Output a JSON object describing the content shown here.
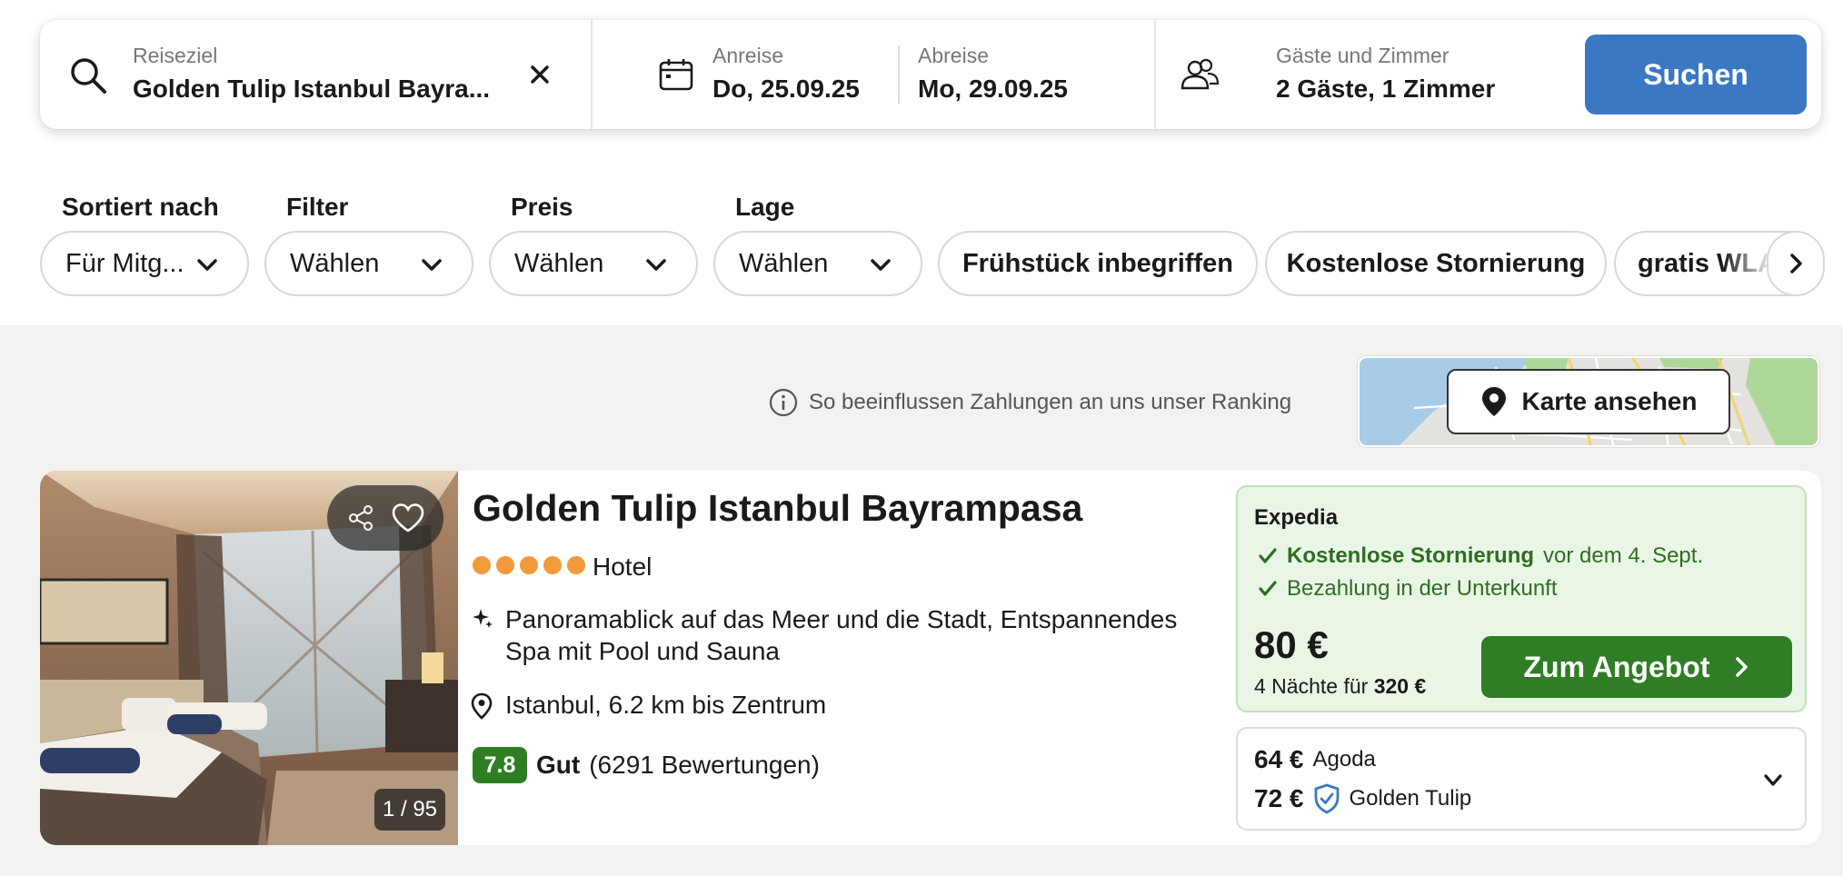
{
  "search": {
    "destination_label": "Reiseziel",
    "destination_value": "Golden Tulip Istanbul Bayra...",
    "checkin_label": "Anreise",
    "checkin_value": "Do, 25.09.25",
    "checkout_label": "Abreise",
    "checkout_value": "Mo, 29.09.25",
    "guests_label": "Gäste und Zimmer",
    "guests_value": "2 Gäste, 1 Zimmer",
    "search_button": "Suchen"
  },
  "filters": {
    "sort_label": "Sortiert nach",
    "sort_value": "Für Mitg...",
    "filter_label": "Filter",
    "filter_value": "Wählen",
    "price_label": "Preis",
    "price_value": "Wählen",
    "location_label": "Lage",
    "location_value": "Wählen",
    "chips": [
      "Frühstück inbegriffen",
      "Kostenlose Stornierung",
      "gratis WLAN"
    ]
  },
  "ranking_info": "So beeinflussen Zahlungen an uns unser Ranking",
  "map_button": "Karte ansehen",
  "hotel": {
    "name": "Golden Tulip Istanbul Bayrampasa",
    "stars": 5,
    "type": "Hotel",
    "highlights": "Panoramablick auf das Meer und die Stadt, Entspannendes Spa mit Pool und Sauna",
    "location": "Istanbul, 6.2 km bis Zentrum",
    "rating_score": "7.8",
    "rating_label": "Gut",
    "review_count": "(6291 Bewertungen)",
    "photo_counter": "1 / 95"
  },
  "offer": {
    "provider": "Expedia",
    "cancellation_bold": "Kostenlose Stornierung",
    "cancellation_rest": "vor dem 4. Sept.",
    "payment": "Bezahlung in der Unterkunft",
    "price": "80 €",
    "nights_prefix": "4 Nächte für",
    "total": "320 €",
    "deal_button": "Zum Angebot"
  },
  "other_offers": [
    {
      "price": "64 €",
      "provider": "Agoda"
    },
    {
      "price": "72 €",
      "provider": "Golden Tulip"
    }
  ],
  "colors": {
    "primary_blue": "#3a78c3",
    "deal_green": "#2f7d24",
    "offer_bg": "#e9f6e6",
    "star_orange": "#f39a3a"
  }
}
